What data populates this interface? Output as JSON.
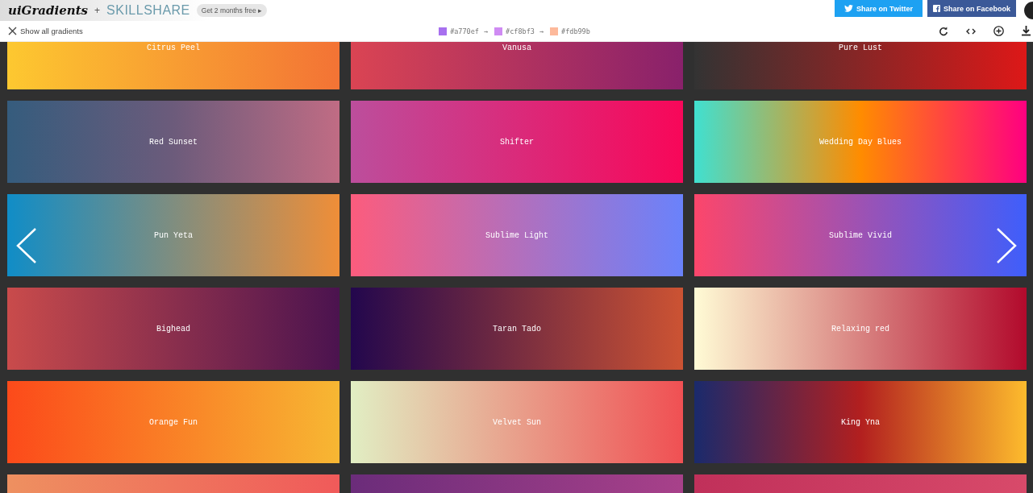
{
  "header": {
    "logo": "uiGradients",
    "plus": "+",
    "partner": "SKILLSHARE",
    "promo": "Get 2 months free ▸",
    "share_buttons": [
      {
        "label": "Share on Twitter",
        "kind": "twitter"
      },
      {
        "label": "Share on Facebook",
        "kind": "facebook"
      }
    ]
  },
  "toolbar": {
    "show_all": "Show all gradients",
    "stops": [
      {
        "hex": "#a770ef",
        "color": "#a770ef"
      },
      {
        "hex": "#cf8bf3",
        "color": "#cf8bf3"
      },
      {
        "hex": "#fdb99b",
        "color": "#fdb99b"
      }
    ],
    "arrow": "→"
  },
  "gradients": [
    {
      "name": "Citrus Peel",
      "stops": [
        {
          "color": "#fdc830"
        },
        {
          "color": "#f37335"
        }
      ]
    },
    {
      "name": "Vanusa",
      "stops": [
        {
          "color": "#da4453"
        },
        {
          "color": "#89216b"
        }
      ]
    },
    {
      "name": "Pure Lust",
      "stops": [
        {
          "color": "#333333"
        },
        {
          "color": "#dd1818"
        }
      ]
    },
    {
      "name": "Red Sunset",
      "stops": [
        {
          "color": "#355c7d"
        },
        {
          "color": "#6c5b7b"
        },
        {
          "color": "#c06c84"
        }
      ]
    },
    {
      "name": "Shifter",
      "stops": [
        {
          "color": "#bc4e9c"
        },
        {
          "color": "#f80759"
        }
      ]
    },
    {
      "name": "Wedding Day Blues",
      "stops": [
        {
          "color": "#40e0d0"
        },
        {
          "color": "#ff8c00"
        },
        {
          "color": "#ff0080"
        }
      ]
    },
    {
      "name": "Pun Yeta",
      "stops": [
        {
          "color": "#108dc7"
        },
        {
          "color": "#ef8e38"
        }
      ]
    },
    {
      "name": "Sublime Light",
      "stops": [
        {
          "color": "#fc5c7d"
        },
        {
          "color": "#6a82fb"
        }
      ]
    },
    {
      "name": "Sublime Vivid",
      "stops": [
        {
          "color": "#fc466b"
        },
        {
          "color": "#3f5efb"
        }
      ]
    },
    {
      "name": "Bighead",
      "stops": [
        {
          "color": "#c94b4b"
        },
        {
          "color": "#4b134f"
        }
      ]
    },
    {
      "name": "Taran Tado",
      "stops": [
        {
          "color": "#23074d"
        },
        {
          "color": "#cc5333"
        }
      ]
    },
    {
      "name": "Relaxing red",
      "stops": [
        {
          "color": "#fffbd5"
        },
        {
          "color": "#b20a2c"
        }
      ]
    },
    {
      "name": "Orange Fun",
      "stops": [
        {
          "color": "#fc4a1a"
        },
        {
          "color": "#f7b733"
        }
      ]
    },
    {
      "name": "Velvet Sun",
      "stops": [
        {
          "color": "#e1eec3"
        },
        {
          "color": "#f05053"
        }
      ]
    },
    {
      "name": "King Yna",
      "stops": [
        {
          "color": "#1a2a6c"
        },
        {
          "color": "#b21f1f"
        },
        {
          "color": "#fdbb2d"
        }
      ]
    },
    {
      "stops": [
        {
          "color": "#ee9060"
        },
        {
          "color": "#f05a5a"
        }
      ]
    },
    {
      "stops": [
        {
          "color": "#6b2c7a"
        },
        {
          "color": "#a8418a"
        }
      ]
    },
    {
      "stops": [
        {
          "color": "#c0305a"
        },
        {
          "color": "#d84a6a"
        }
      ]
    }
  ]
}
